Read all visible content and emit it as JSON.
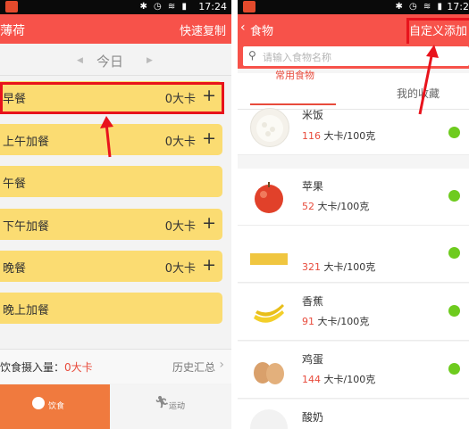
{
  "status": {
    "time": "17:24",
    "time_right": "17:2"
  },
  "left": {
    "app_title": "薄荷",
    "quick_copy": "快速复制",
    "day_label": "今日",
    "meals": [
      {
        "name": "早餐",
        "value": "0大卡",
        "has_plus": true
      },
      {
        "name": "上午加餐",
        "value": "0大卡",
        "has_plus": true
      },
      {
        "name": "午餐",
        "value": "",
        "has_plus": false
      },
      {
        "name": "下午加餐",
        "value": "0大卡",
        "has_plus": true
      },
      {
        "name": "晚餐",
        "value": "0大卡",
        "has_plus": true
      },
      {
        "name": "晚上加餐",
        "value": "",
        "has_plus": false
      }
    ],
    "summary_label": "饮食摄入量：",
    "summary_value": "0大卡",
    "history": "历史汇总",
    "tab_diet": "饮食",
    "tab_sport": "运动"
  },
  "right": {
    "title": "食物",
    "custom_add": "自定义添加",
    "search_placeholder": "请输入食物名称",
    "tab_common": "常用食物",
    "tab_favorites": "我的收藏",
    "foods": [
      {
        "name": "米饭",
        "kcal_num": "116",
        "kcal_unit": " 大卡/100克"
      },
      {
        "name": "苹果",
        "kcal_num": "52",
        "kcal_unit": " 大卡/100克"
      },
      {
        "name": "",
        "kcal_num": "321",
        "kcal_unit": " 大卡/100克"
      },
      {
        "name": "香蕉",
        "kcal_num": "91",
        "kcal_unit": " 大卡/100克"
      },
      {
        "name": "鸡蛋",
        "kcal_num": "144",
        "kcal_unit": " 大卡/100克"
      },
      {
        "name": "酸奶",
        "kcal_num": "",
        "kcal_unit": ""
      }
    ]
  },
  "colors": {
    "header": "#f7524a",
    "meal": "#fbdc72",
    "accent": "#e84b3c",
    "highlight": "#e8131c",
    "dot": "#6ecb1e",
    "tab_active": "#f07a3e"
  }
}
